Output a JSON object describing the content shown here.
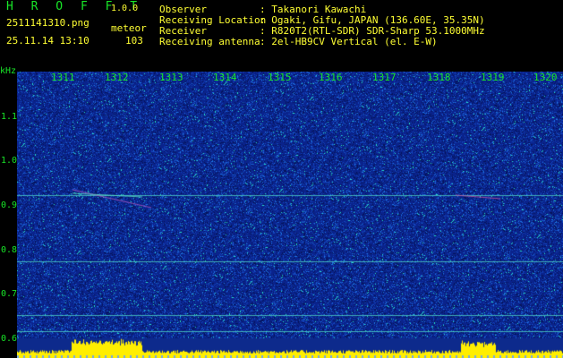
{
  "header": {
    "brand": "H R O F F T",
    "version": "1.0.0",
    "filename": "2511141310.png",
    "datetime": "25.11.14 13:10",
    "mode": "meteor",
    "count": "103"
  },
  "info": {
    "observer_label": "Observer",
    "observer_value": ": Takanori Kawachi",
    "location_label": "Receiving Location",
    "location_value": ": Ogaki, Gifu, JAPAN (136.60E, 35.35N)",
    "receiver_label": "Receiver",
    "receiver_value": ": R820T2(RTL-SDR) SDR-Sharp 53.1000MHz",
    "antenna_label": "Receiving antenna",
    "antenna_value": ": 2el-HB9CV Vertical (el. E-W)"
  },
  "axis": {
    "unit": "kHz",
    "x_ticks": [
      "1311",
      "1312",
      "1313",
      "1314",
      "1315",
      "1316",
      "1317",
      "1318",
      "1319",
      "1320"
    ],
    "y_ticks": [
      "1.1",
      "1.0",
      "0.9",
      "0.8",
      "0.7",
      "0.6"
    ]
  },
  "colors": {
    "background": "#000000",
    "label_green": "#18e628",
    "label_yellow": "#ffff33",
    "spectrum_base": "#0d2a8c",
    "power_bar": "#ffee00"
  }
}
